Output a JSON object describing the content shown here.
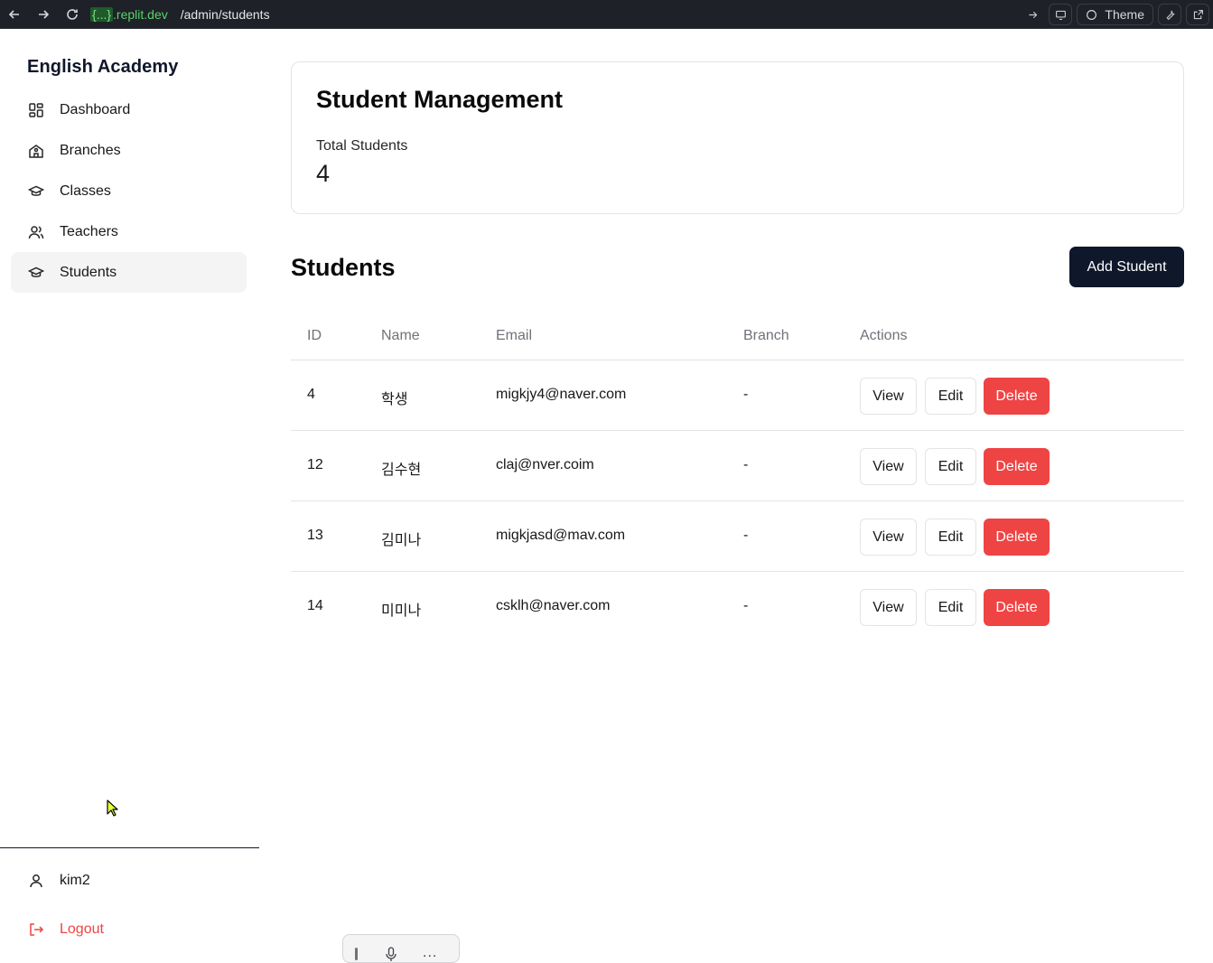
{
  "browser": {
    "url_braces": "{...}",
    "url_domain": ".replit.dev",
    "url_path": "/admin/students",
    "theme_label": "Theme"
  },
  "sidebar": {
    "brand": "English Academy",
    "items": [
      {
        "label": "Dashboard",
        "icon": "layout-dashboard-icon"
      },
      {
        "label": "Branches",
        "icon": "school-icon"
      },
      {
        "label": "Classes",
        "icon": "graduation-cap-icon"
      },
      {
        "label": "Teachers",
        "icon": "users-icon"
      },
      {
        "label": "Students",
        "icon": "graduation-cap-icon",
        "active": true
      }
    ],
    "user": "kim2",
    "logout": "Logout"
  },
  "summary": {
    "title": "Student Management",
    "label": "Total Students",
    "value": "4"
  },
  "students": {
    "title": "Students",
    "add_label": "Add Student",
    "columns": [
      "ID",
      "Name",
      "Email",
      "Branch",
      "Actions"
    ],
    "rows": [
      {
        "id": "4",
        "name": "학생",
        "email": "migkjy4@naver.com",
        "branch": "-"
      },
      {
        "id": "12",
        "name": "김수현",
        "email": "claj@nver.coim",
        "branch": "-"
      },
      {
        "id": "13",
        "name": "김미나",
        "email": "migkjasd@mav.com",
        "branch": "-"
      },
      {
        "id": "14",
        "name": "미미나",
        "email": "csklh@naver.com",
        "branch": "-"
      }
    ],
    "actions": {
      "view": "View",
      "edit": "Edit",
      "delete": "Delete"
    }
  },
  "float_toolbar": {
    "more": "..."
  },
  "colors": {
    "primary": "#0f172a",
    "danger": "#ef4444",
    "active_bg": "#f4f4f5",
    "border": "#e4e4e7"
  }
}
